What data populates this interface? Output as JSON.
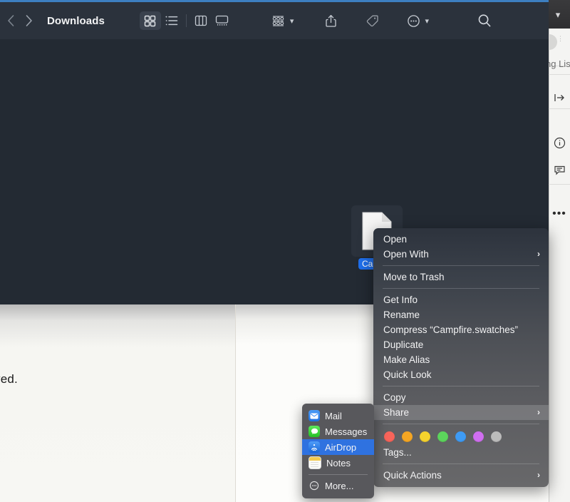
{
  "window": {
    "title": "Downloads",
    "back_icon": "chevron-left-icon",
    "forward_icon": "chevron-right-icon",
    "view_buttons": [
      {
        "name": "icon-view",
        "icon": "grid-icon",
        "active": true
      },
      {
        "name": "list-view",
        "icon": "list-icon",
        "active": false
      },
      {
        "name": "column-view",
        "icon": "columns-icon",
        "active": false
      },
      {
        "name": "gallery-view",
        "icon": "gallery-icon",
        "active": false
      }
    ],
    "tools": [
      {
        "name": "group-by",
        "icon": "group-icon",
        "has_chevron": true
      },
      {
        "name": "share",
        "icon": "share-icon",
        "has_chevron": false
      },
      {
        "name": "tags",
        "icon": "tag-icon",
        "has_chevron": false
      },
      {
        "name": "more-actions",
        "icon": "ellipsis-circle-icon",
        "has_chevron": true
      },
      {
        "name": "search",
        "icon": "search-icon",
        "has_chevron": false
      }
    ]
  },
  "file": {
    "label": "Campfire.swatches",
    "label_visible": "Campfir",
    "icon": "document-icon",
    "selected": true
  },
  "context_menu": {
    "groups": [
      [
        {
          "label": "Open",
          "submenu": false
        },
        {
          "label": "Open With",
          "submenu": true
        }
      ],
      [
        {
          "label": "Move to Trash",
          "submenu": false
        }
      ],
      [
        {
          "label": "Get Info",
          "submenu": false
        },
        {
          "label": "Rename",
          "submenu": false
        },
        {
          "label": "Compress “Campfire.swatches”",
          "submenu": false
        },
        {
          "label": "Duplicate",
          "submenu": false
        },
        {
          "label": "Make Alias",
          "submenu": false
        },
        {
          "label": "Quick Look",
          "submenu": false
        }
      ],
      [
        {
          "label": "Copy",
          "submenu": false
        },
        {
          "label": "Share",
          "submenu": true,
          "highlighted": true
        }
      ]
    ],
    "tags": {
      "label": "Tags...",
      "colors": [
        "#f7645a",
        "#f5a623",
        "#f6d32d",
        "#5cd45c",
        "#3e9bf5",
        "#d06ef0",
        "#bcbcbc"
      ],
      "color_names": [
        "red",
        "orange",
        "yellow",
        "green",
        "blue",
        "purple",
        "gray"
      ]
    },
    "quick_actions": {
      "label": "Quick Actions",
      "submenu": true
    },
    "arrow_glyph": "›"
  },
  "share_menu": {
    "items": [
      {
        "label": "Mail",
        "icon": "mail-icon",
        "color": "#3b8cf5",
        "glyph": "✉",
        "highlighted": false
      },
      {
        "label": "Messages",
        "icon": "messages-icon",
        "color": "#3ad13a",
        "glyph": "●",
        "highlighted": false
      },
      {
        "label": "AirDrop",
        "icon": "airdrop-icon",
        "color": "#1e73e8",
        "glyph": "◔",
        "highlighted": true
      },
      {
        "label": "Notes",
        "icon": "notes-icon",
        "color": "#f3cf52",
        "glyph": "",
        "highlighted": false
      }
    ],
    "more": {
      "label": "More...",
      "icon": "ellipsis-circle-icon"
    }
  },
  "background": {
    "document_text": "ved.",
    "right_app": {
      "label": "ng List",
      "icons": [
        "sidebar-toggle-icon",
        "info-icon",
        "comment-icon",
        "ellipsis-icon"
      ],
      "chevron": "chevron-down-icon"
    }
  }
}
